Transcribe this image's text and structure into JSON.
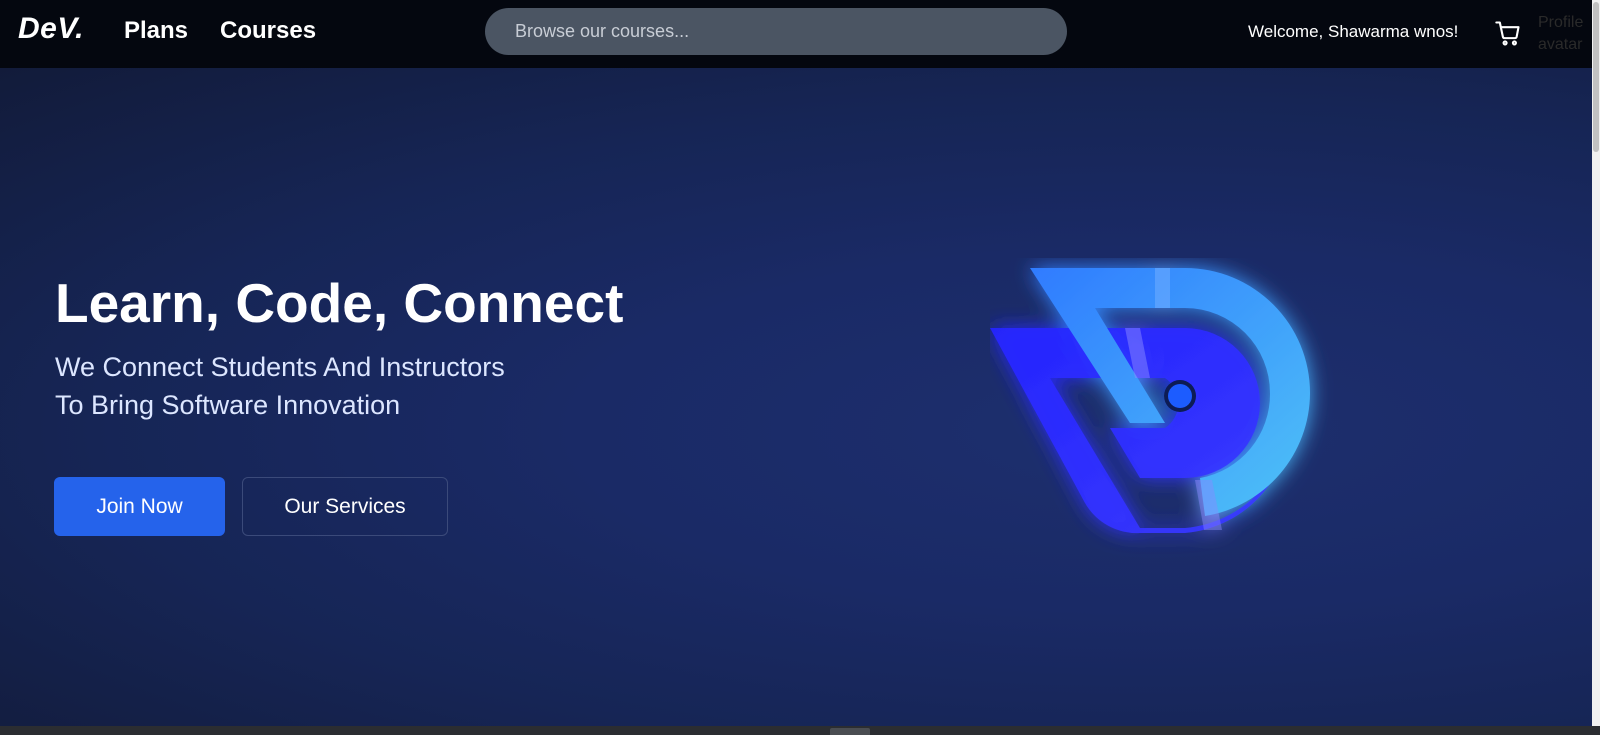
{
  "nav": {
    "logo": "DeV.",
    "links": [
      "Plans",
      "Courses"
    ],
    "search_placeholder": "Browse our courses...",
    "welcome": "Welcome, Shawarma wnos!",
    "cart_icon": "cart-icon",
    "profile_alt": [
      "Profile",
      "avatar"
    ]
  },
  "hero": {
    "title": "Learn, Code, Connect",
    "subtitle_line1": "We Connect Students And Instructors",
    "subtitle_line2": "To Bring Software Innovation",
    "join_label": "Join Now",
    "services_label": "Our Services"
  },
  "colors": {
    "navbar": "#04070f",
    "hero_bg": "#1a2a66",
    "primary": "#2563eb",
    "logo_blue_light": "#3b82f6",
    "logo_blue_dark": "#1d1dff"
  }
}
